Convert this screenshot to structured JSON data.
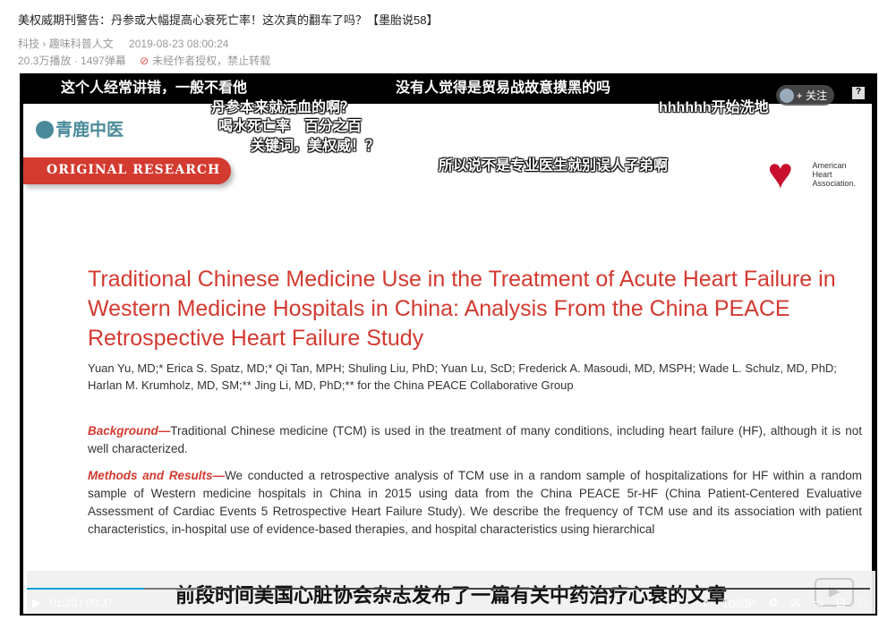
{
  "page": {
    "title": "美权威期刊警告：丹参或大幅提高心衰死亡率！这次真的翻车了吗？【墨胎说58】",
    "category": "科技",
    "subcategory": "趣味科普人文",
    "date": "2019-08-23 08:00:24",
    "views": "20.3万播放",
    "danmaku_count": "1497弹幕",
    "copyright": "未经作者授权，禁止转载"
  },
  "video": {
    "slide": {
      "logo": "青鹿中医",
      "label": "ORIGINAL RESEARCH",
      "org": [
        "American",
        "Heart",
        "Association."
      ],
      "title": "Traditional Chinese Medicine Use in the Treatment of Acute Heart Failure in Western Medicine Hospitals in China: Analysis From the China PEACE Retrospective Heart Failure Study",
      "authors": "Yuan Yu, MD;* Erica S. Spatz, MD;* Qi Tan, MPH; Shuling Liu, PhD; Yuan Lu, ScD; Frederick A. Masoudi, MD, MSPH; Wade L. Schulz, MD, PhD; Harlan M. Krumholz, MD, SM;** Jing Li, MD, PhD;** for the China PEACE Collaborative Group",
      "bg_label": "Background—",
      "bg_text": "Traditional Chinese medicine (TCM) is used in the treatment of many conditions, including heart failure (HF), although it is not well characterized.",
      "mr_label": "Methods and Results—",
      "mr_text": "We conducted a retrospective analysis of TCM use in a random sample of hospitalizations for HF within a random sample of Western medicine hospitals in China in 2015 using data from the China PEACE 5r-HF (China Patient-Centered Evaluative Assessment of Cardiac Events 5 Retrospective Heart Failure Study). We describe the frequency of TCM use and its association with patient characteristics, in-hospital use of evidence-based therapies, and hospital characteristics using hierarchical"
    },
    "subtitle": "前段时间美国心脏协会杂志发布了一篇有关中药治疗心衰的文章",
    "danmaku": [
      "这个人经常讲错，一般不看他",
      "没有人觉得是贸易战故意摸黑的吗",
      "丹参本来就活血的啊？",
      "hhhhhh开始洗地",
      "喝水死亡率　百分之百",
      "关键词，美权威！？",
      "所以说不是专业医生就别误人子弟啊"
    ],
    "follow": "+ 关注",
    "help": "?",
    "current_time": "01:20",
    "duration": "09:37",
    "progress_percent": 13.9,
    "buffered_percent": 22,
    "quality": "1080P"
  },
  "colors": {
    "accent": "#00a1d6",
    "red": "#d33a30"
  }
}
